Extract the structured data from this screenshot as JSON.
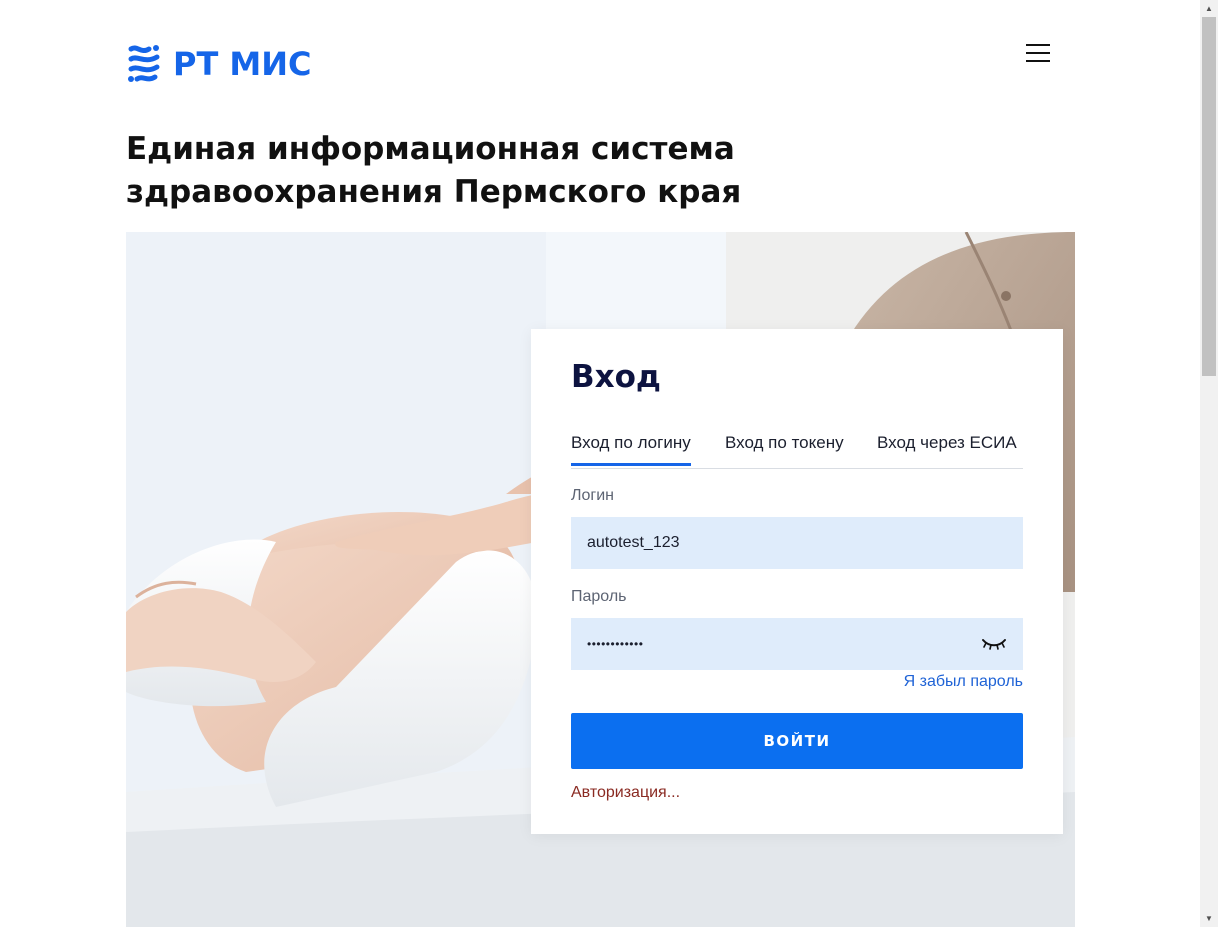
{
  "header": {
    "logo_text": "РТ МИС",
    "menu_icon": "hamburger-menu-icon",
    "logo_icon": "rtmis-logo-icon",
    "brand_color": "#1565e8"
  },
  "page_title": {
    "line1": "Единая информационная система",
    "line2": "здравоохранения Пермского края"
  },
  "login": {
    "title": "Вход",
    "tabs": [
      {
        "label": "Вход по логину",
        "active": true
      },
      {
        "label": "Вход по токену",
        "active": false
      },
      {
        "label": "Вход через ЕСИА",
        "active": false
      }
    ],
    "login_label": "Логин",
    "login_value": "autotest_123",
    "password_label": "Пароль",
    "password_value": "••••••••••••",
    "password_toggle_icon": "eye-closed-icon",
    "forgot_password": "Я забыл пароль",
    "submit_label": "ВОЙТИ",
    "status_text": "Авторизация...",
    "accent_color": "#0b6ff0",
    "field_bg": "#dfecfb"
  }
}
